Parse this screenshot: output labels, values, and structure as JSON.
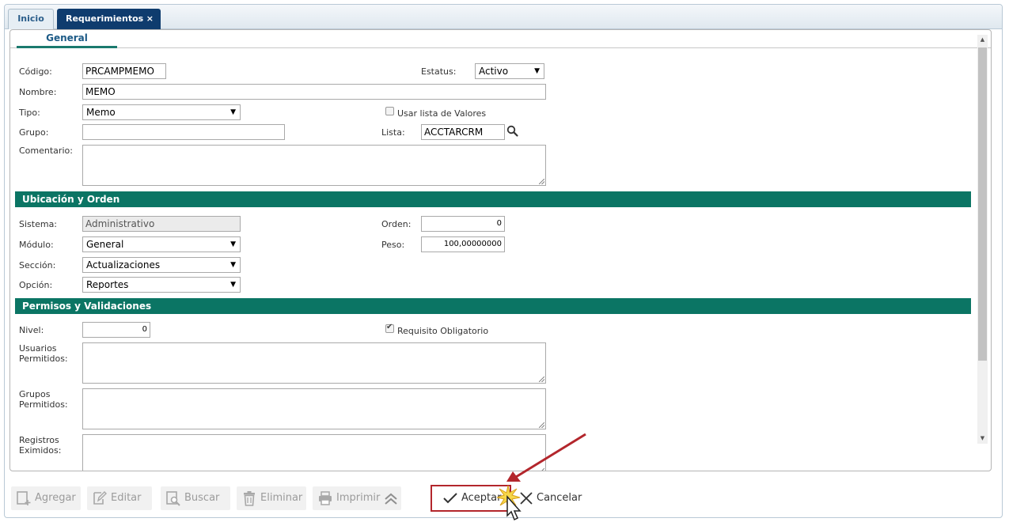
{
  "tabs": {
    "inicio": "Inicio",
    "requerimientos": "Requerimientos",
    "close": "×"
  },
  "subtab": "General",
  "fields": {
    "codigo": {
      "label": "Código:",
      "value": "PRCAMPMEMO"
    },
    "estatus": {
      "label": "Estatus:",
      "value": "Activo"
    },
    "nombre": {
      "label": "Nombre:",
      "value": "MEMO"
    },
    "tipo": {
      "label": "Tipo:",
      "value": "Memo"
    },
    "usar_lista": {
      "label": "Usar lista de Valores",
      "checked": false
    },
    "grupo": {
      "label": "Grupo:",
      "value": ""
    },
    "lista": {
      "label": "Lista:",
      "value": "ACCTARCRM"
    },
    "comentario": {
      "label": "Comentario:",
      "value": ""
    }
  },
  "section_ubicacion": {
    "title": "Ubicación y Orden",
    "sistema": {
      "label": "Sistema:",
      "value": "Administrativo"
    },
    "orden": {
      "label": "Orden:",
      "value": "0"
    },
    "modulo": {
      "label": "Módulo:",
      "value": "General"
    },
    "peso": {
      "label": "Peso:",
      "value": "100,00000000"
    },
    "seccion": {
      "label": "Sección:",
      "value": "Actualizaciones"
    },
    "opcion": {
      "label": "Opción:",
      "value": "Reportes"
    }
  },
  "section_permisos": {
    "title": "Permisos y Validaciones",
    "nivel": {
      "label": "Nivel:",
      "value": "0"
    },
    "requisito": {
      "label": "Requisito Obligatorio",
      "checked": true
    },
    "usuarios_l1": "Usuarios",
    "usuarios_l2": "Permitidos:",
    "grupos_l1": "Grupos",
    "grupos_l2": "Permitidos:",
    "registros_l1": "Registros",
    "registros_l2": "Eximidos:"
  },
  "toolbar": {
    "agregar": "Agregar",
    "editar": "Editar",
    "buscar": "Buscar",
    "eliminar": "Eliminar",
    "imprimir": "Imprimir",
    "aceptar": "Aceptar",
    "cancelar": "Cancelar"
  },
  "colors": {
    "section_header": "#0b7564",
    "active_tab": "#0f3c6e",
    "highlight": "#b3262c"
  }
}
